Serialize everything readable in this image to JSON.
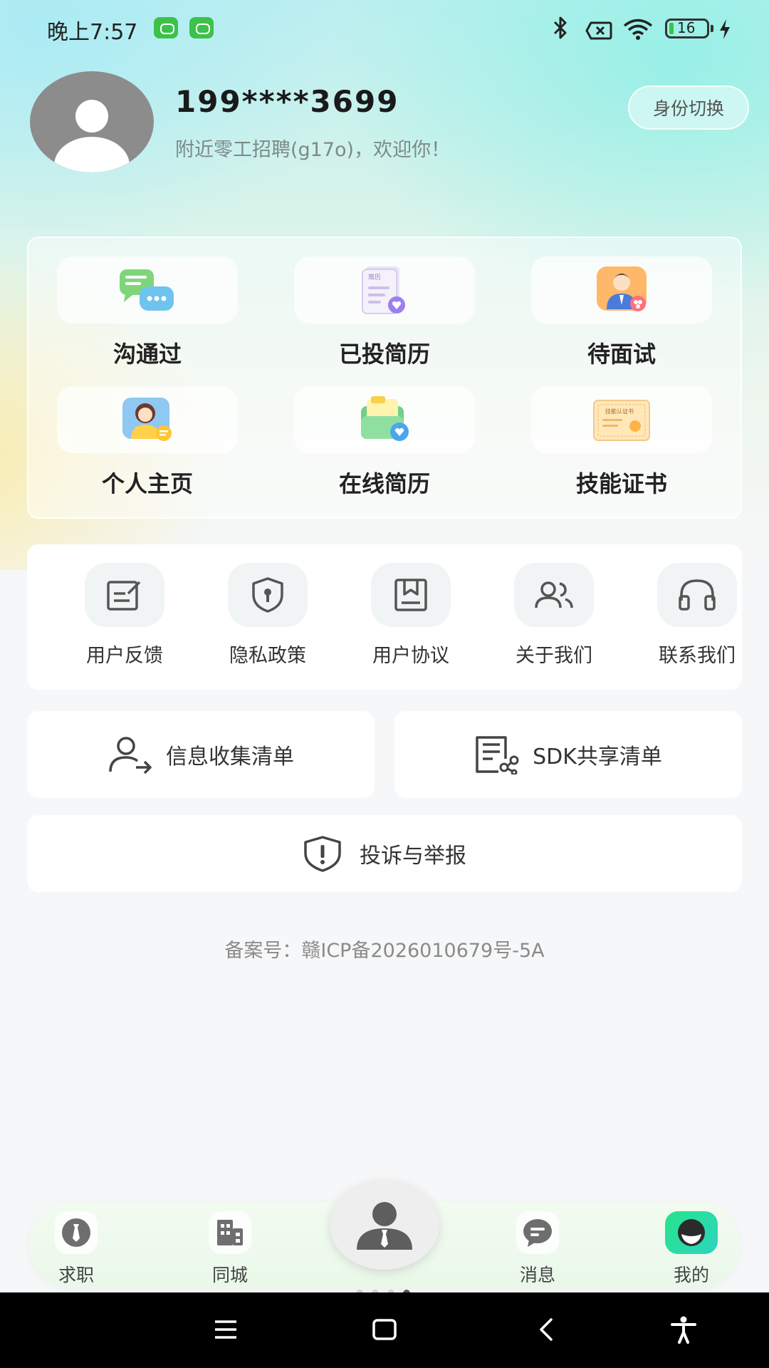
{
  "status_bar": {
    "time": "晚上7:57",
    "battery": "16",
    "icons": [
      "wechat-icon",
      "wechat-icon",
      "bluetooth-icon",
      "sim-off-icon",
      "wifi-icon",
      "battery-icon",
      "charging-icon"
    ]
  },
  "profile": {
    "username": "199****3699",
    "welcome": "附近零工招聘(g17o)，欢迎你！",
    "switch_label": "身份切换"
  },
  "quick_actions": [
    {
      "label": "沟通过",
      "icon": "chat-bubbles-icon"
    },
    {
      "label": "已投简历",
      "icon": "resume-sent-icon"
    },
    {
      "label": "待面试",
      "icon": "interviewer-icon"
    },
    {
      "label": "个人主页",
      "icon": "profile-person-icon"
    },
    {
      "label": "在线简历",
      "icon": "online-resume-icon"
    },
    {
      "label": "技能证书",
      "icon": "certificate-icon"
    }
  ],
  "certificate_text": "技能认证书",
  "resume_text": "简历",
  "links": [
    {
      "label": "用户反馈",
      "icon": "feedback-icon"
    },
    {
      "label": "隐私政策",
      "icon": "privacy-shield-icon"
    },
    {
      "label": "用户协议",
      "icon": "agreement-icon"
    },
    {
      "label": "关于我们",
      "icon": "about-users-icon"
    },
    {
      "label": "联系我们",
      "icon": "headset-icon"
    }
  ],
  "info_collection": "信息收集清单",
  "sdk_sharing": "SDK共享清单",
  "complaint": "投诉与举报",
  "icp": "备案号：赣ICP备2026010679号-5A",
  "tabs": [
    {
      "label": "求职",
      "icon": "tie-icon"
    },
    {
      "label": "同城",
      "icon": "building-icon"
    },
    {
      "label": "消息",
      "icon": "message-icon"
    },
    {
      "label": "我的",
      "icon": "me-icon",
      "active": true
    }
  ],
  "colors": {
    "accent": "#26e58a",
    "bg": "#f6f7f8"
  }
}
